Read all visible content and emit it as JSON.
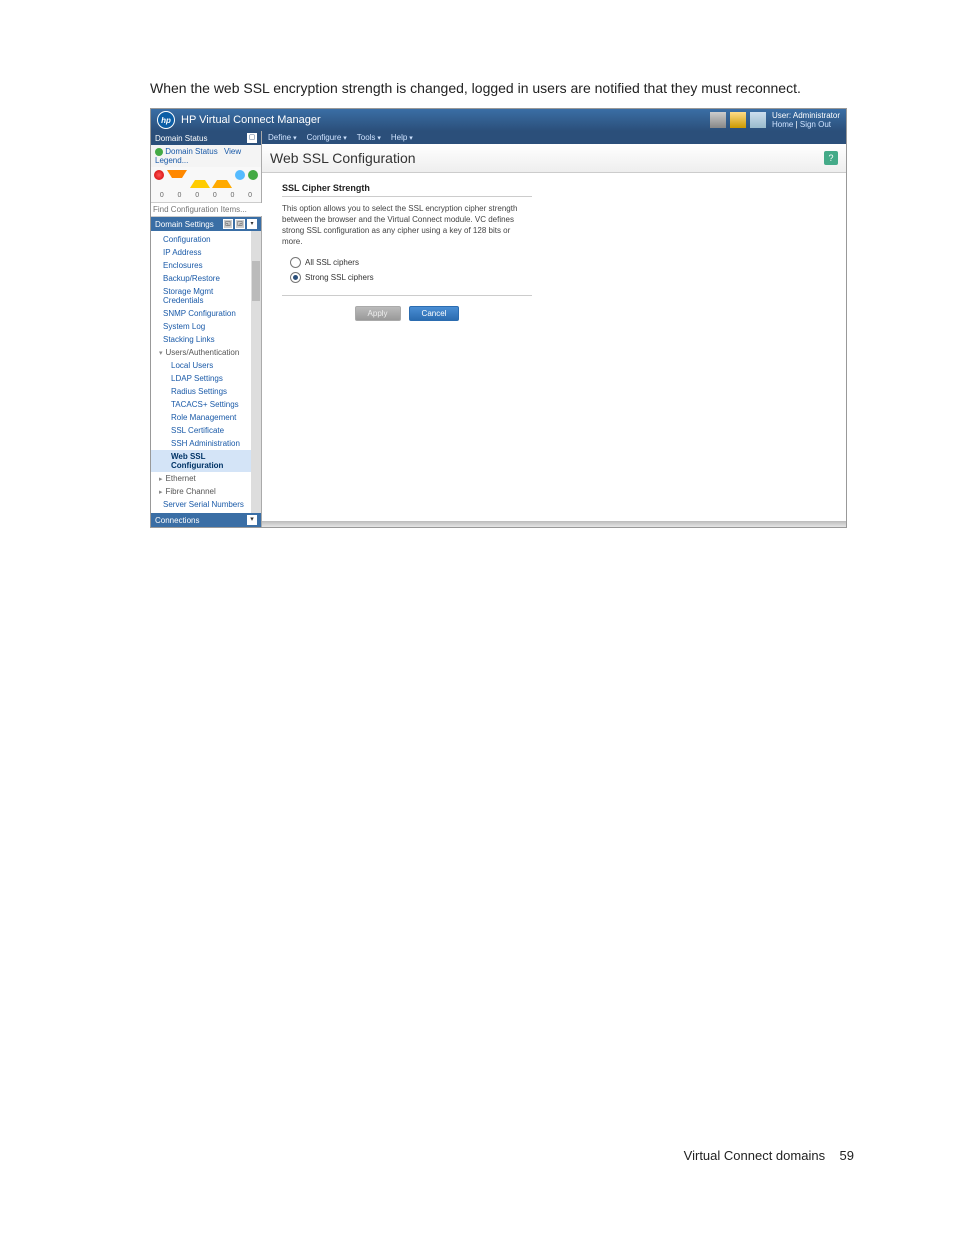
{
  "intro_text": "When the web SSL encryption strength is changed, logged in users are notified that they must reconnect.",
  "titlebar": {
    "logo_text": "hp",
    "title": "HP Virtual Connect Manager",
    "user_label": "User:",
    "user_name": "Administrator",
    "home_link": "Home",
    "signout_link": "Sign Out"
  },
  "sidebar": {
    "domain_status_header": "Domain Status",
    "domain_status_link": "Domain Status",
    "view_legend_link": "View Legend...",
    "status_counts": [
      "0",
      "0",
      "0",
      "0",
      "0",
      "0"
    ],
    "find_placeholder": "Find Configuration Items...",
    "domain_settings_header": "Domain Settings",
    "nav_items": [
      "Configuration",
      "IP Address",
      "Enclosures",
      "Backup/Restore",
      "Storage Mgmt Credentials",
      "SNMP Configuration",
      "System Log",
      "Stacking Links"
    ],
    "users_auth_header": "Users/Authentication",
    "users_auth_items": [
      "Local Users",
      "LDAP Settings",
      "Radius Settings",
      "TACACS+ Settings",
      "Role Management",
      "SSL Certificate",
      "SSH Administration",
      "Web SSL Configuration"
    ],
    "ethernet_header": "Ethernet",
    "fibre_header": "Fibre Channel",
    "fibre_items": [
      "Server Serial Numbers"
    ],
    "connections_header": "Connections"
  },
  "menubar": {
    "items": [
      "Define",
      "Configure",
      "Tools",
      "Help"
    ]
  },
  "main": {
    "page_title": "Web SSL Configuration",
    "panel_title": "SSL Cipher Strength",
    "panel_desc": "This option allows you to select the SSL encryption cipher strength between the browser and the Virtual Connect module. VC defines strong SSL configuration as any cipher using a key of 128 bits or more.",
    "radio_all": "All SSL ciphers",
    "radio_strong": "Strong SSL ciphers",
    "apply_label": "Apply",
    "cancel_label": "Cancel"
  },
  "footer": {
    "section": "Virtual Connect domains",
    "page_num": "59"
  }
}
